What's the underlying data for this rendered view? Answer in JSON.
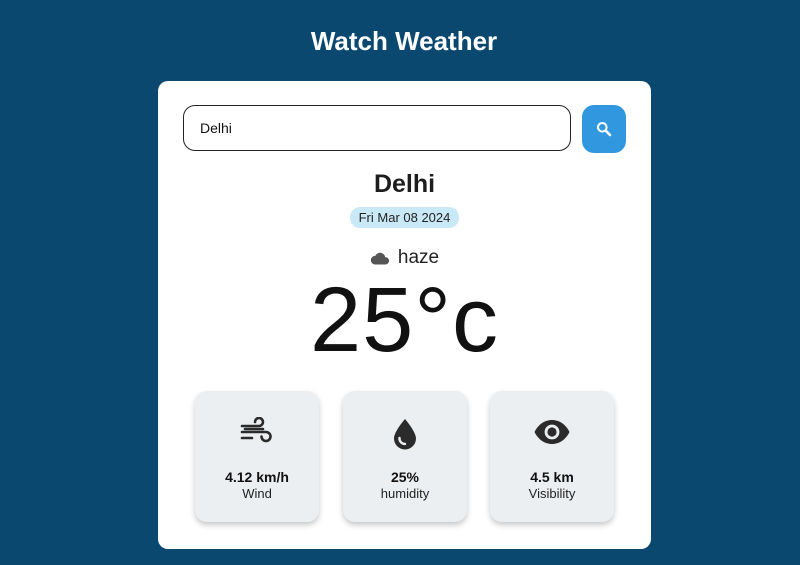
{
  "app": {
    "title": "Watch Weather"
  },
  "search": {
    "value": "Delhi",
    "button_icon": "search-icon"
  },
  "weather": {
    "city": "Delhi",
    "date": "Fri Mar 08 2024",
    "condition": "haze",
    "condition_icon": "cloud-icon",
    "temperature": "25°c"
  },
  "stats": [
    {
      "icon": "wind-icon",
      "value": "4.12 km/h",
      "label": "Wind"
    },
    {
      "icon": "droplet-icon",
      "value": "25%",
      "label": "humidity"
    },
    {
      "icon": "eye-icon",
      "value": "4.5 km",
      "label": "Visibility"
    }
  ],
  "colors": {
    "background": "#0b4870",
    "accent": "#3198e0",
    "date_badge": "#c9e9f6",
    "stat_card": "#eceff1"
  }
}
